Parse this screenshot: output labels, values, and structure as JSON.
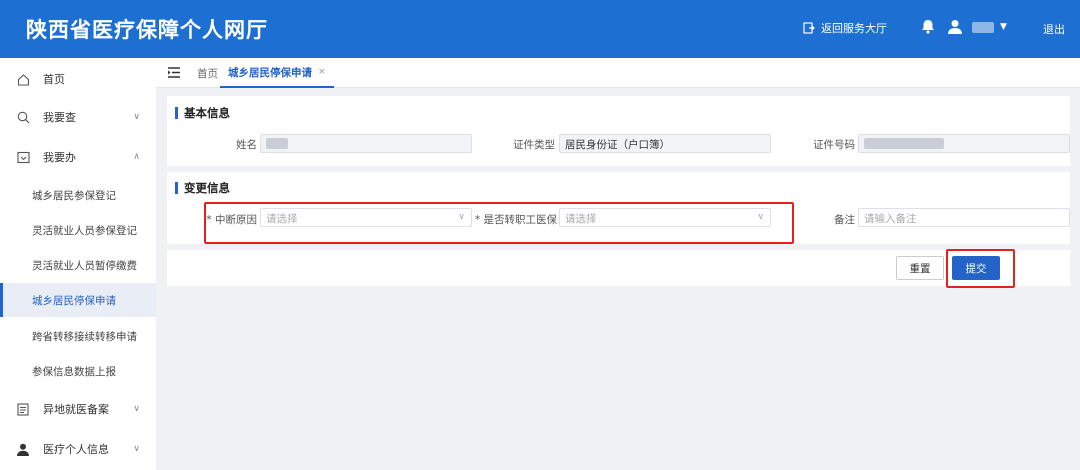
{
  "header": {
    "title": "陕西省医疗保障个人网厅",
    "back_label": "返回服务大厅",
    "logout_label": "退出"
  },
  "sidebar": {
    "items": [
      {
        "label": "首页"
      },
      {
        "label": "我要查"
      },
      {
        "label": "我要办"
      }
    ],
    "sub_items": [
      {
        "label": "城乡居民参保登记"
      },
      {
        "label": "灵活就业人员参保登记"
      },
      {
        "label": "灵活就业人员暂停缴费"
      },
      {
        "label": "城乡居民停保申请"
      },
      {
        "label": "跨省转移接续转移申请"
      },
      {
        "label": "参保信息数据上报"
      }
    ],
    "bottom_items": [
      {
        "label": "异地就医备案"
      },
      {
        "label": "医疗个人信息"
      }
    ]
  },
  "tabbar": {
    "home_label": "首页",
    "active_tab": "城乡居民停保申请",
    "close_glyph": "×"
  },
  "basic_info": {
    "title": "基本信息",
    "name_label": "姓名",
    "id_type_label": "证件类型",
    "id_type_value": "居民身份证（户口簿）",
    "id_number_label": "证件号码"
  },
  "change_info": {
    "title": "变更信息",
    "reason_label": "* 中断原因",
    "reason_placeholder": "请选择",
    "transfer_label": "* 是否转职工医保",
    "transfer_placeholder": "请选择",
    "remark_label": "备注",
    "remark_placeholder": "请输入备注"
  },
  "actions": {
    "reset_label": "重置",
    "submit_label": "提交"
  },
  "colors": {
    "header_bg": "#1d6fd1",
    "accent": "#2463c7",
    "highlight_red": "#e0231d"
  }
}
